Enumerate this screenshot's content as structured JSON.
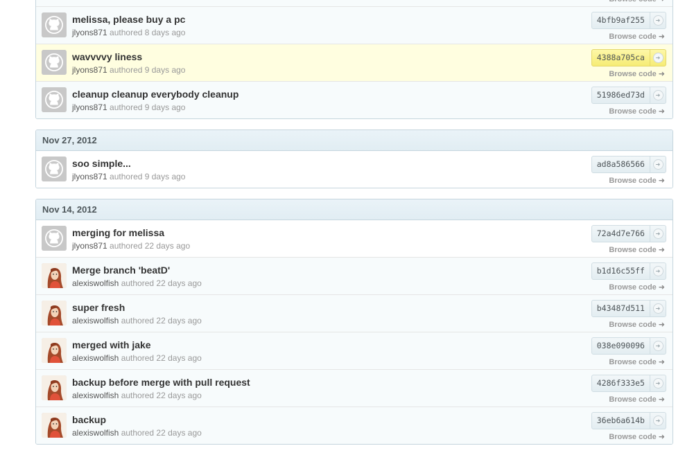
{
  "groups": [
    {
      "date": "",
      "commits": [
        {
          "message": "",
          "author": "",
          "authored": "",
          "sha": "",
          "browse": "Browse code",
          "avatar": "octocat"
        },
        {
          "message": "melissa, please buy a pc",
          "author": "jlyons871",
          "authored": "authored 8 days ago",
          "sha": "4bfb9af255",
          "browse": "Browse code",
          "avatar": "octocat"
        },
        {
          "message": "wavvvvy liness",
          "author": "jlyons871",
          "authored": "authored 9 days ago",
          "sha": "4388a705ca",
          "browse": "Browse code",
          "avatar": "octocat",
          "highlight": true
        },
        {
          "message": "cleanup cleanup everybody cleanup",
          "author": "jlyons871",
          "authored": "authored 9 days ago",
          "sha": "51986ed73d",
          "browse": "Browse code",
          "avatar": "octocat"
        }
      ]
    },
    {
      "date": "Nov 27, 2012",
      "commits": [
        {
          "message": "soo simple...",
          "author": "jlyons871",
          "authored": "authored 9 days ago",
          "sha": "ad8a586566",
          "browse": "Browse code",
          "avatar": "octocat"
        }
      ]
    },
    {
      "date": "Nov 14, 2012",
      "commits": [
        {
          "message": "merging for melissa",
          "author": "jlyons871",
          "authored": "authored 22 days ago",
          "sha": "72a4d7e766",
          "browse": "Browse code",
          "avatar": "octocat"
        },
        {
          "message": "Merge branch 'beatD'",
          "author": "alexiswolfish",
          "authored": "authored 22 days ago",
          "sha": "b1d16c55ff",
          "browse": "Browse code",
          "avatar": "girl"
        },
        {
          "message": "super fresh",
          "author": "alexiswolfish",
          "authored": "authored 22 days ago",
          "sha": "b43487d511",
          "browse": "Browse code",
          "avatar": "girl"
        },
        {
          "message": "merged with jake",
          "author": "alexiswolfish",
          "authored": "authored 22 days ago",
          "sha": "038e090096",
          "browse": "Browse code",
          "avatar": "girl"
        },
        {
          "message": "backup before merge with pull request",
          "author": "alexiswolfish",
          "authored": "authored 22 days ago",
          "sha": "4286f333e5",
          "browse": "Browse code",
          "avatar": "girl"
        },
        {
          "message": "backup",
          "author": "alexiswolfish",
          "authored": "authored 22 days ago",
          "sha": "36eb6a614b",
          "browse": "Browse code",
          "avatar": "girl"
        }
      ]
    }
  ],
  "icons": {
    "sha_link": "arrow-circle-icon",
    "browse": "arrow-right-icon"
  },
  "colors": {
    "highlight_row": "#fffee0",
    "highlight_sha": "#fbf48f",
    "group_header": "#e6f1f6"
  }
}
